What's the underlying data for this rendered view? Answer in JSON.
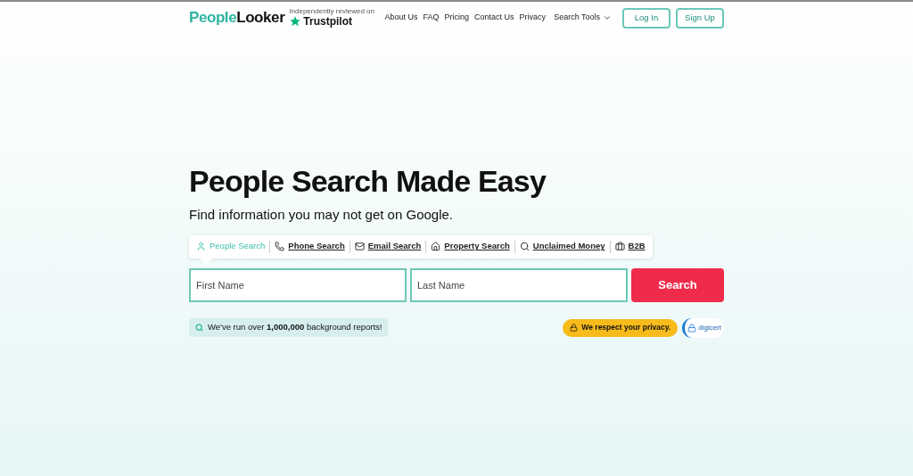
{
  "header": {
    "logo": {
      "first": "People",
      "second": "Looker"
    },
    "review_note": "Independently reviewed on",
    "trustpilot": "Trustpilot",
    "nav": [
      {
        "label": "About Us",
        "kind": "link"
      },
      {
        "label": "FAQ",
        "kind": "link"
      },
      {
        "label": "Pricing",
        "kind": "link"
      },
      {
        "label": "Contact Us",
        "kind": "link"
      },
      {
        "label": "Privacy",
        "kind": "link"
      },
      {
        "label": "Search Tools",
        "kind": "dropdown"
      }
    ],
    "buttons": [
      "Log In",
      "Sign Up"
    ]
  },
  "hero": {
    "title": "People Search Made Easy",
    "subtitle": "Find information you may not get on Google.",
    "tabs": [
      {
        "label": "People Search",
        "kind": "person",
        "selected": true
      },
      {
        "label": "Phone Search",
        "kind": "phone",
        "selected": false
      },
      {
        "label": "Email Search",
        "kind": "email",
        "selected": false
      },
      {
        "label": "Property Search",
        "kind": "house",
        "selected": false
      },
      {
        "label": "Unclaimed Money",
        "kind": "magnifier",
        "selected": false
      },
      {
        "label": "B2B",
        "kind": "briefcase",
        "selected": false
      }
    ],
    "fields": [
      {
        "placeholder": "First Name"
      },
      {
        "placeholder": "Last Name"
      }
    ],
    "search_button": "Search",
    "stat": "We've run over **1,000,000** background reports!",
    "privacy": "We respect your privacy.",
    "seal": "digicert"
  }
}
